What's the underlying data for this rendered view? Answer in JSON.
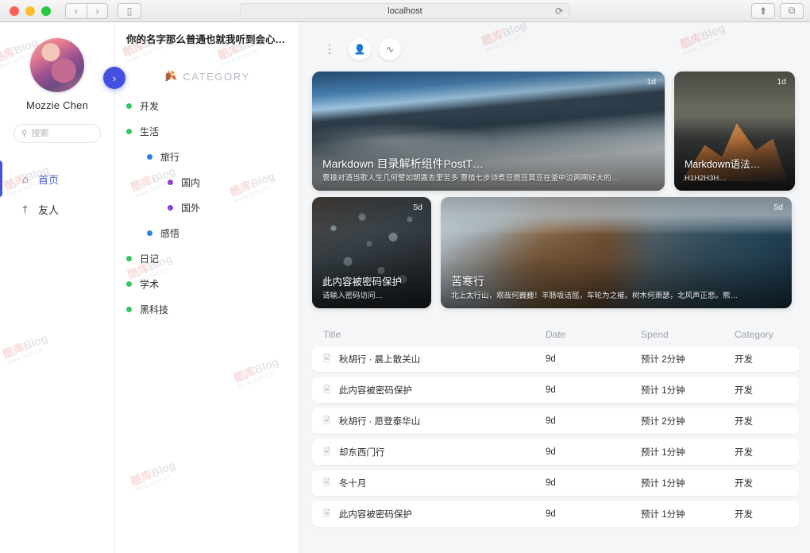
{
  "browser": {
    "url": "localhost",
    "back_label": "‹",
    "forward_label": "›",
    "sidebar_toggle_label": "▯",
    "reload_label": "⟳",
    "share_label": "⬆",
    "tabs_label": "⧉"
  },
  "profile": {
    "name": "Mozzie Chen",
    "search_placeholder": "搜索",
    "search_value": "",
    "nav": [
      {
        "label": "首页",
        "icon": "home-icon",
        "glyph": "⌂",
        "active": true
      },
      {
        "label": "友人",
        "icon": "person-icon",
        "glyph": "†",
        "active": false
      }
    ]
  },
  "sidebar": {
    "site_title": "你的名字那么普通也就我听到会心…",
    "category_label": "CATEGORY",
    "leaf_icon": "leaf-icon",
    "expand_label": "›",
    "categories": [
      {
        "label": "开发",
        "level": 0,
        "color": "#35c75a"
      },
      {
        "label": "生活",
        "level": 0,
        "color": "#35c75a"
      },
      {
        "label": "旅行",
        "level": 1,
        "color": "#2f7fe8"
      },
      {
        "label": "国内",
        "level": 2,
        "color": "#8b3fd4"
      },
      {
        "label": "国外",
        "level": 2,
        "color": "#8b3fd4"
      },
      {
        "label": "感悟",
        "level": 1,
        "color": "#2f7fe8"
      },
      {
        "label": "日记",
        "level": 0,
        "color": "#35c75a"
      },
      {
        "label": "学术",
        "level": 0,
        "color": "#35c75a"
      },
      {
        "label": "黑科技",
        "level": 0,
        "color": "#35c75a"
      }
    ]
  },
  "toolbar": {
    "more_label": "⋮",
    "user_label": "👤",
    "rss_label": "≋"
  },
  "cards": [
    {
      "title": "Markdown 目录解析组件PostT…",
      "subtitle": "曹操对酒当歌人生几何譬如朝露去里苦多 曹植七步诗煮豆燃豆萁豆在釜中泣两啊好大的…",
      "badge": "1d",
      "size": "big",
      "image": "snow-mountain-photo"
    },
    {
      "title": "Markdown语法…",
      "subtitle": "H1H2H3H…",
      "badge": "1d",
      "size": "small",
      "image": "orange-peak-photo"
    },
    {
      "title": "此内容被密码保护",
      "subtitle": "请输入密码访问…",
      "badge": "5d",
      "size": "tiny",
      "image": "water-droplets-photo"
    },
    {
      "title": "苦寒行",
      "subtitle": "北上太行山，艰哉何巍巍！羊肠坂诘屈，车轮为之摧。树木何萧瑟，北风声正悲。熊…",
      "badge": "5d",
      "size": "wide",
      "image": "coastline-photo"
    }
  ],
  "table": {
    "headers": {
      "title": "Title",
      "date": "Date",
      "spend": "Spend",
      "category": "Category"
    },
    "rows": [
      {
        "title": "秋胡行 · 晨上散关山",
        "date": "9d",
        "spend": "预计 2分钟",
        "category": "开发"
      },
      {
        "title": "此内容被密码保护",
        "date": "9d",
        "spend": "预计 1分钟",
        "category": "开发"
      },
      {
        "title": "秋胡行 · 愿登泰华山",
        "date": "9d",
        "spend": "预计 2分钟",
        "category": "开发"
      },
      {
        "title": "却东西门行",
        "date": "9d",
        "spend": "预计 1分钟",
        "category": "开发"
      },
      {
        "title": "冬十月",
        "date": "9d",
        "spend": "预计 1分钟",
        "category": "开发"
      },
      {
        "title": "此内容被密码保护",
        "date": "9d",
        "spend": "预计 1分钟",
        "category": "开发"
      }
    ]
  },
  "watermark": {
    "line1_a": "酷库",
    "line1_b": "Blog",
    "line2": "www.zxki.cn"
  },
  "colors": {
    "accent": "#4450e0",
    "page_bg": "#f5f6f7",
    "card_radius": "#ffffff"
  }
}
